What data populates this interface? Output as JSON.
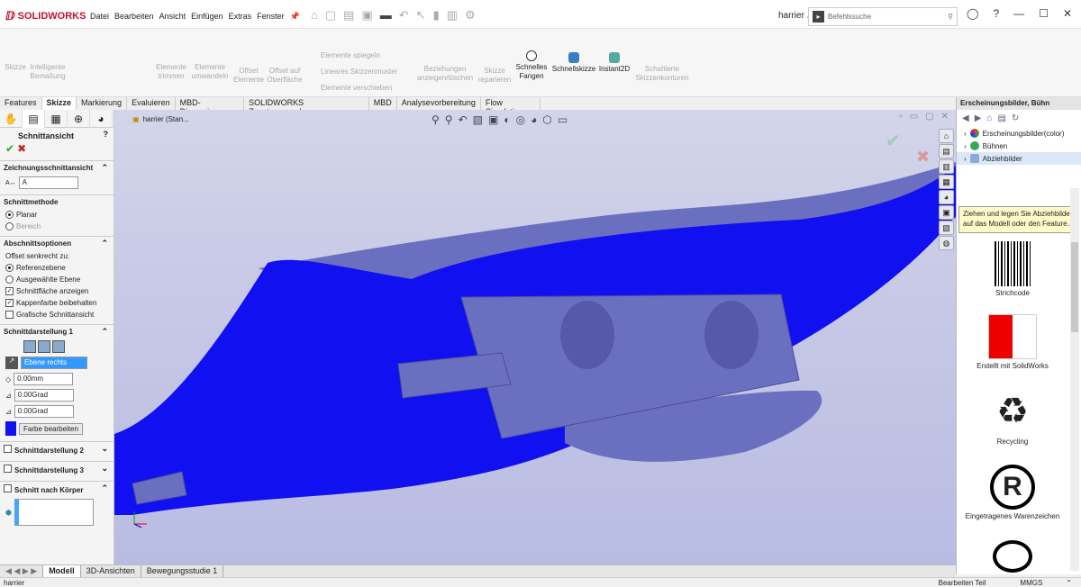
{
  "app": {
    "logo": "SOLIDWORKS",
    "menus": [
      "Datei",
      "Bearbeiten",
      "Ansicht",
      "Einfügen",
      "Extras",
      "Fenster"
    ],
    "doc_name": "harrier ...",
    "search_placeholder": "Befehlssuche"
  },
  "ribbon": {
    "buttons": [
      {
        "label": "Skizze",
        "enabled": false
      },
      {
        "label": "Intelligente Bemaßung",
        "enabled": false
      },
      {
        "label": "Elemente trimmen",
        "enabled": false
      },
      {
        "label": "Elemente umwandeln",
        "enabled": false
      },
      {
        "label": "Offset Elemente",
        "enabled": false
      },
      {
        "label": "Offset auf Oberfläche",
        "enabled": false
      },
      {
        "label": "Elemente spiegeln",
        "enabled": false
      },
      {
        "label": "Lineares Skizzenmuster",
        "enabled": false
      },
      {
        "label": "Elemente verschieben",
        "enabled": false
      },
      {
        "label": "Beziehungen anzeigen/löschen",
        "enabled": false
      },
      {
        "label": "Skizze reparieren",
        "enabled": false
      },
      {
        "label": "Schnelles Fangen",
        "enabled": true
      },
      {
        "label": "Schnellskizze",
        "enabled": true
      },
      {
        "label": "Instant2D",
        "enabled": true
      },
      {
        "label": "Schattierte Skizzenkonturen",
        "enabled": false
      }
    ]
  },
  "command_tabs": [
    "Features",
    "Skizze",
    "Markierung",
    "Evaluieren",
    "MBD-Dimensionen",
    "SOLIDWORKS Zusatzanwendungen",
    "MBD",
    "Analysevorbereitung",
    "Flow Simulation"
  ],
  "active_tab": "Skizze",
  "property_manager": {
    "title": "Schnittansicht",
    "zeichnung_label": "Zeichnungsschnittansicht",
    "zeichnung_value": "A",
    "methode_label": "Schnittmethode",
    "planar": "Planar",
    "bereich": "Bereich",
    "optionen_label": "Abschnittsoptionen",
    "offset_label": "Offset senkrecht zu:",
    "ref_ebene": "Referenzebene",
    "ausgew_ebene": "Ausgewählte Ebene",
    "chk1": "Schnittfläche anzeigen",
    "chk2": "Kappenfarbe beibehalten",
    "chk3": "Grafische Schnittansicht",
    "darst1": "Schnittdarstellung 1",
    "plane_value": "Ebene rechts",
    "dist": "0.00mm",
    "angle1": "0.00Grad",
    "angle2": "0.00Grad",
    "farbe_btn": "Farbe bearbeiten",
    "darst2": "Schnittdarstellung 2",
    "darst3": "Schnittdarstellung 3",
    "koerper": "Schnitt nach Körper"
  },
  "viewport": {
    "tree_label": "harrier (Stan...",
    "cap_color": "#1010f0",
    "model_color": "#6b6fbf"
  },
  "task_pane": {
    "header": "Erscheinungsbilder, Bühn",
    "tree": [
      "Erscheinungsbilder(color)",
      "Bühnen",
      "Abziehbilder"
    ],
    "tooltip": "Ziehen und legen Sie Abziehbilder auf das Modell oder den Feature...",
    "decals": [
      "Strichcode",
      "Erstellt mit SolidWorks",
      "Recycling",
      "Eingetragenes Warenzeichen"
    ]
  },
  "bottom_tabs": [
    "Modell",
    "3D-Ansichten",
    "Bewegungsstudie 1"
  ],
  "status": {
    "left": "harrier",
    "mid": "Bearbeiten Teil",
    "units": "MMGS"
  }
}
